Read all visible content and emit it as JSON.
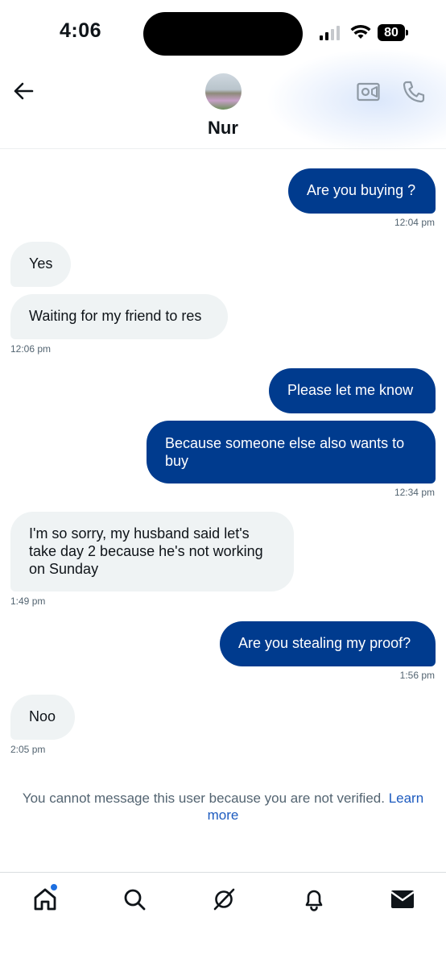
{
  "status_bar": {
    "time": "4:06",
    "battery": "80"
  },
  "header": {
    "contact_name": "Nur"
  },
  "messages": [
    {
      "text": "Are you buying ?"
    },
    {
      "text": "12:04 pm"
    },
    {
      "text": "Yes"
    },
    {
      "text": "Waiting for my friend to res"
    },
    {
      "text": "12:06 pm"
    },
    {
      "text": "Please let me know"
    },
    {
      "text": "Because someone else also wants to buy"
    },
    {
      "text": "12:34 pm"
    },
    {
      "text": "I'm so sorry, my husband said let's take day 2 because he's not working on Sunday"
    },
    {
      "text": "1:49 pm"
    },
    {
      "text": "Are you stealing my proof?"
    },
    {
      "text": "1:56 pm"
    },
    {
      "text": "Noo"
    },
    {
      "text": "2:05 pm"
    }
  ],
  "notice": {
    "text": "You cannot message this user because you are not verified. ",
    "link": "Learn more"
  },
  "nav": {
    "items": [
      "home-icon",
      "search-icon",
      "grok-icon",
      "notifications-icon",
      "messages-icon"
    ]
  }
}
